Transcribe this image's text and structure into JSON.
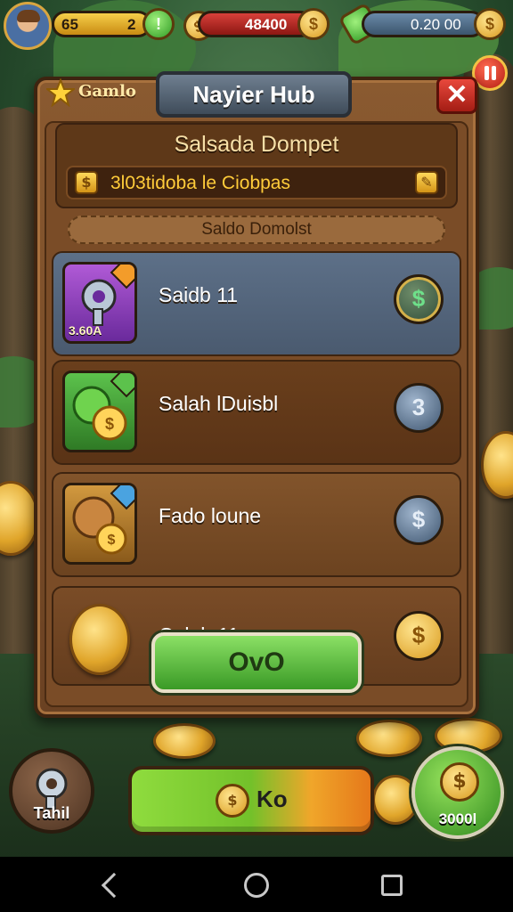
{
  "hud": {
    "level": "65",
    "xp_value": "2",
    "coins": "48400",
    "gems": "0.20 00"
  },
  "panel": {
    "tab_label": "Gamlo",
    "title": "Nayier Hub",
    "close_symbol": "✕",
    "header_title": "Salsada Dompet",
    "header_line": "3l03tidoba le Ciobpas",
    "section_label": "Saldo Domolst"
  },
  "rows": [
    {
      "label": "Saidb 11",
      "item_price": "3.60A",
      "button_symbol": "$"
    },
    {
      "label": "Salah lDuisbl",
      "item_price": "",
      "button_symbol": "3"
    },
    {
      "label": "Fado loune",
      "item_price": "",
      "button_symbol": "$"
    },
    {
      "label": "Caloh 11",
      "item_price": "",
      "button_symbol": "$"
    }
  ],
  "ok_button": "OvO",
  "bottom": {
    "left_label": "Tahil",
    "main_label": "Ko",
    "right_label": "3000l"
  },
  "icons": {
    "coin": "$",
    "edit": "✎"
  },
  "colors": {
    "panel_wood": "#7a4c27",
    "primary_green": "#3a9a26",
    "accent_gold": "#d99a1f",
    "close_red": "#a41d14"
  }
}
